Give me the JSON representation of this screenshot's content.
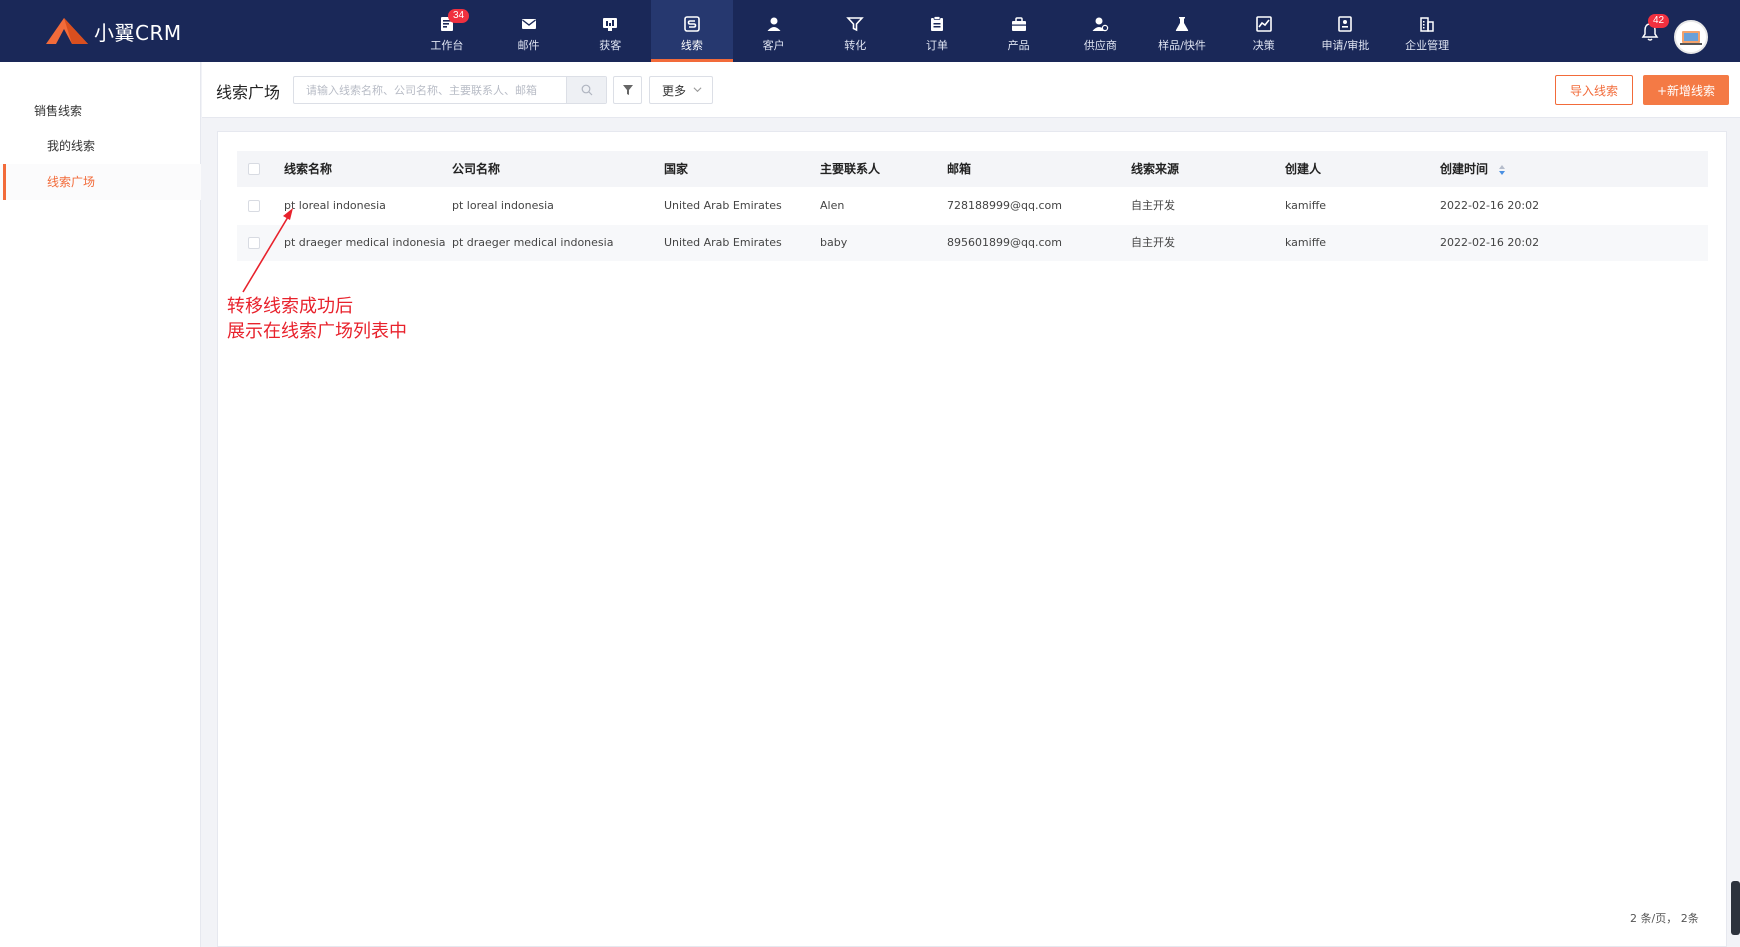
{
  "app": {
    "logo_text": "小翼CRM"
  },
  "nav": [
    {
      "label": "工作台",
      "icon": "dashboard-icon",
      "badge": "34"
    },
    {
      "label": "邮件",
      "icon": "mail-icon"
    },
    {
      "label": "获客",
      "icon": "acquire-icon"
    },
    {
      "label": "线索",
      "icon": "leads-icon",
      "active": true
    },
    {
      "label": "客户",
      "icon": "customer-icon"
    },
    {
      "label": "转化",
      "icon": "funnel-icon"
    },
    {
      "label": "订单",
      "icon": "order-icon"
    },
    {
      "label": "产品",
      "icon": "product-icon"
    },
    {
      "label": "供应商",
      "icon": "supplier-icon"
    },
    {
      "label": "样品/快件",
      "icon": "sample-icon"
    },
    {
      "label": "决策",
      "icon": "decision-icon"
    },
    {
      "label": "申请/审批",
      "icon": "approval-icon"
    },
    {
      "label": "企业管理",
      "icon": "company-icon"
    }
  ],
  "notifications": {
    "badge": "42"
  },
  "sidebar": {
    "group": "销售线索",
    "items": [
      {
        "label": "我的线索"
      },
      {
        "label": "线索广场",
        "active": true
      }
    ]
  },
  "header": {
    "title": "线索广场",
    "search_placeholder": "请输入线索名称、公司名称、主要联系人、邮箱",
    "more_label": "更多",
    "import_label": "导入线索",
    "add_label": "+新增线索"
  },
  "table": {
    "columns": [
      "线索名称",
      "公司名称",
      "国家",
      "主要联系人",
      "邮箱",
      "线索来源",
      "创建人",
      "创建时间"
    ],
    "rows": [
      [
        "pt loreal indonesia",
        "pt loreal indonesia",
        "United Arab Emirates",
        "Alen",
        "728188999@qq.com",
        "自主开发",
        "kamiffe",
        "2022-02-16 20:02"
      ],
      [
        "pt draeger medical indonesia",
        "pt draeger medical indonesia",
        "United Arab Emirates",
        "baby",
        "895601899@qq.com",
        "自主开发",
        "kamiffe",
        "2022-02-16 20:02"
      ]
    ]
  },
  "annotation": {
    "line1": "转移线索成功后",
    "line2": "展示在线索广场列表中"
  },
  "pagination": {
    "summary": "2 条/页， 2条"
  },
  "colors": {
    "nav_bg": "#1a2858",
    "accent": "#f26b3a",
    "annotation": "#e8222c"
  }
}
